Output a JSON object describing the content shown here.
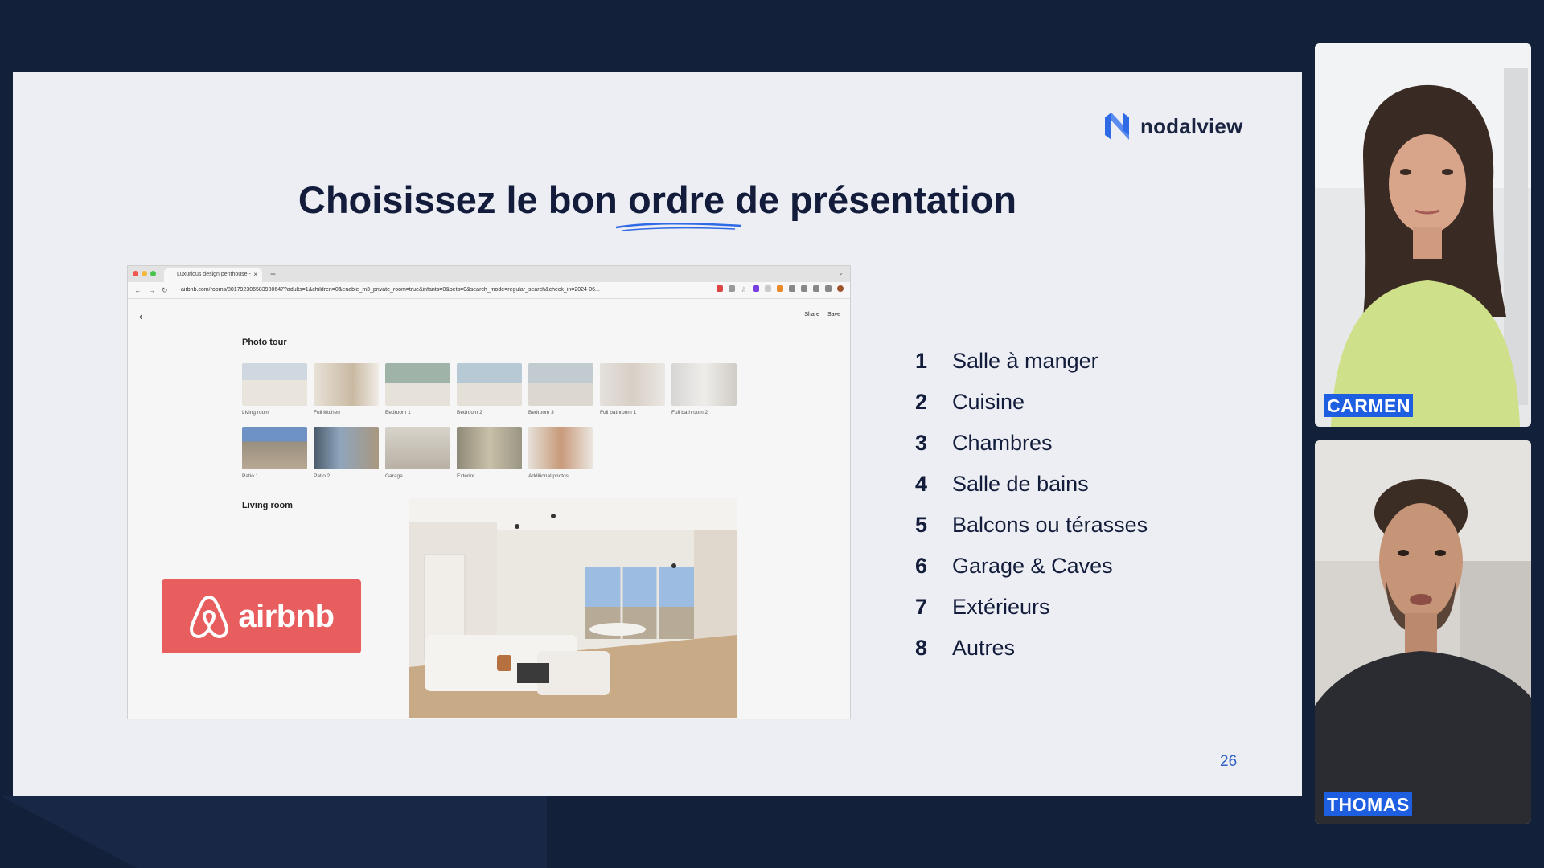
{
  "slide": {
    "logo_text": "nodalview",
    "title": "Choisissez le bon ordre de présentation",
    "page_number": "26",
    "airbnb_text": "airbnb",
    "list": [
      {
        "num": "1",
        "label": "Salle à manger"
      },
      {
        "num": "2",
        "label": "Cuisine"
      },
      {
        "num": "3",
        "label": "Chambres"
      },
      {
        "num": "4",
        "label": "Salle de bains"
      },
      {
        "num": "5",
        "label": "Balcons ou térasses"
      },
      {
        "num": "6",
        "label": "Garage & Caves"
      },
      {
        "num": "7",
        "label": "Extérieurs"
      },
      {
        "num": "8",
        "label": "Autres"
      }
    ]
  },
  "browser": {
    "tab_title": "Luxurious design penthouse -",
    "url": "airbnb.com/rooms/801792306583980647?adults=1&children=0&enable_m3_private_room=true&infants=0&pets=0&search_mode=regular_search&check_in=2024-06...",
    "share_label": "Share",
    "save_label": "Save",
    "photo_tour_title": "Photo tour",
    "thumbnails": [
      "Living room",
      "Full kitchen",
      "Bedroom 1",
      "Bedroom 2",
      "Bedroom 3",
      "Full bathroom 1",
      "Full bathroom 2",
      "Patio 1",
      "Patio 2",
      "Garage",
      "Exterior",
      "Additional photos"
    ],
    "section_label": "Living room"
  },
  "participants": [
    {
      "name": "CARMEN"
    },
    {
      "name": "THOMAS"
    }
  ],
  "colors": {
    "background": "#13203a",
    "slide": "#eceef3",
    "title": "#131d3b",
    "accent_blue": "#1e5ee0",
    "airbnb_red": "#e85d5d"
  }
}
